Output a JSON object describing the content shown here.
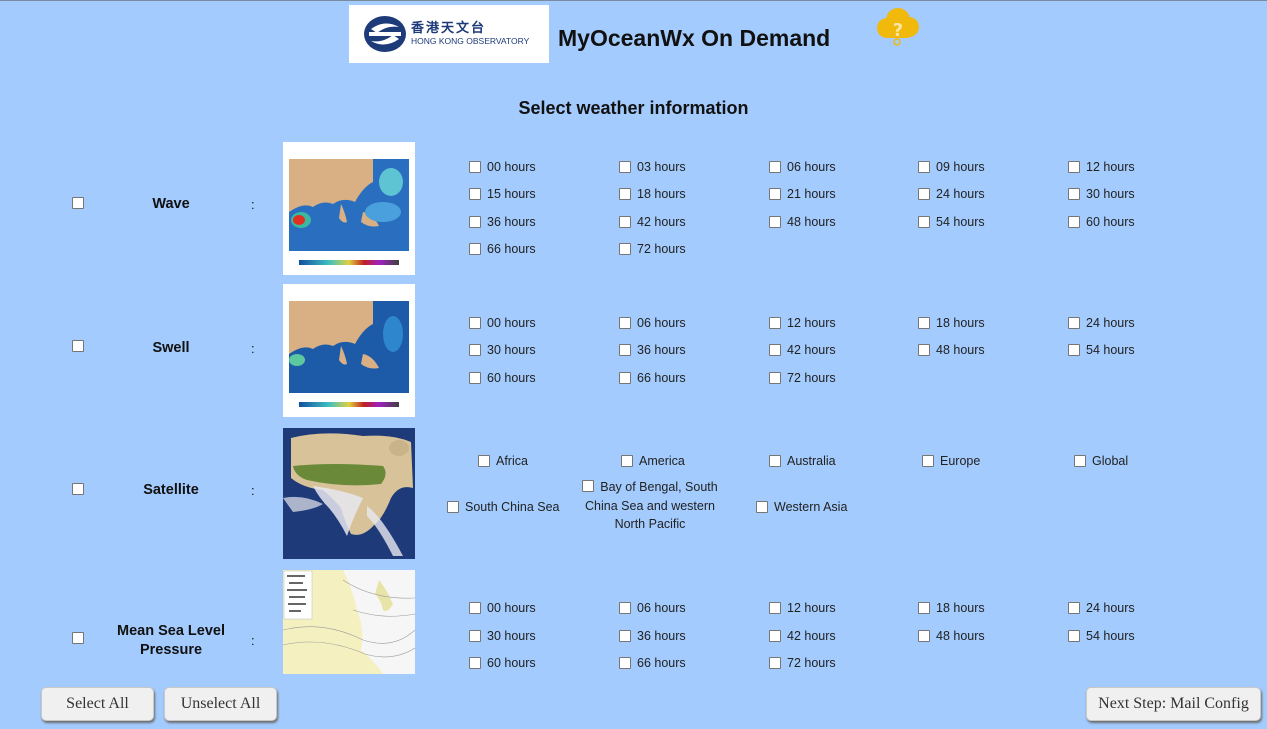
{
  "header": {
    "logo_cn": "香港天文台",
    "logo_en": "HONG KONG OBSERVATORY",
    "title": "MyOceanWx On Demand",
    "help_icon": "cloud-question-icon"
  },
  "section_title": "Select weather information",
  "products": [
    {
      "label": "Wave",
      "colon": ":",
      "thumbnail": "wave-height-map",
      "options": [
        "00 hours",
        "03 hours",
        "06 hours",
        "09 hours",
        "12 hours",
        "15 hours",
        "18 hours",
        "21 hours",
        "24 hours",
        "30 hours",
        "36 hours",
        "42 hours",
        "48 hours",
        "54 hours",
        "60 hours",
        "66 hours",
        "72 hours"
      ]
    },
    {
      "label": "Swell",
      "colon": ":",
      "thumbnail": "swell-height-map",
      "options": [
        "00 hours",
        "06 hours",
        "12 hours",
        "18 hours",
        "24 hours",
        "30 hours",
        "36 hours",
        "42 hours",
        "48 hours",
        "54 hours",
        "60 hours",
        "66 hours",
        "72 hours"
      ]
    },
    {
      "label": "Satellite",
      "colon": ":",
      "thumbnail": "satellite-image-africa",
      "options": [
        "Africa",
        "America",
        "Australia",
        "Europe",
        "Global",
        "South China Sea",
        "Bay of Bengal, South China Sea and western North Pacific",
        "Western Asia"
      ]
    },
    {
      "label": "Mean Sea Level Pressure",
      "colon": ":",
      "thumbnail": "mslp-analysis-chart",
      "options": [
        "00 hours",
        "06 hours",
        "12 hours",
        "18 hours",
        "24 hours",
        "30 hours",
        "36 hours",
        "42 hours",
        "48 hours",
        "54 hours",
        "60 hours",
        "66 hours",
        "72 hours"
      ]
    }
  ],
  "buttons": {
    "select_all": "Select All",
    "unselect_all": "Unselect All",
    "next_step": "Next Step: Mail Config"
  }
}
